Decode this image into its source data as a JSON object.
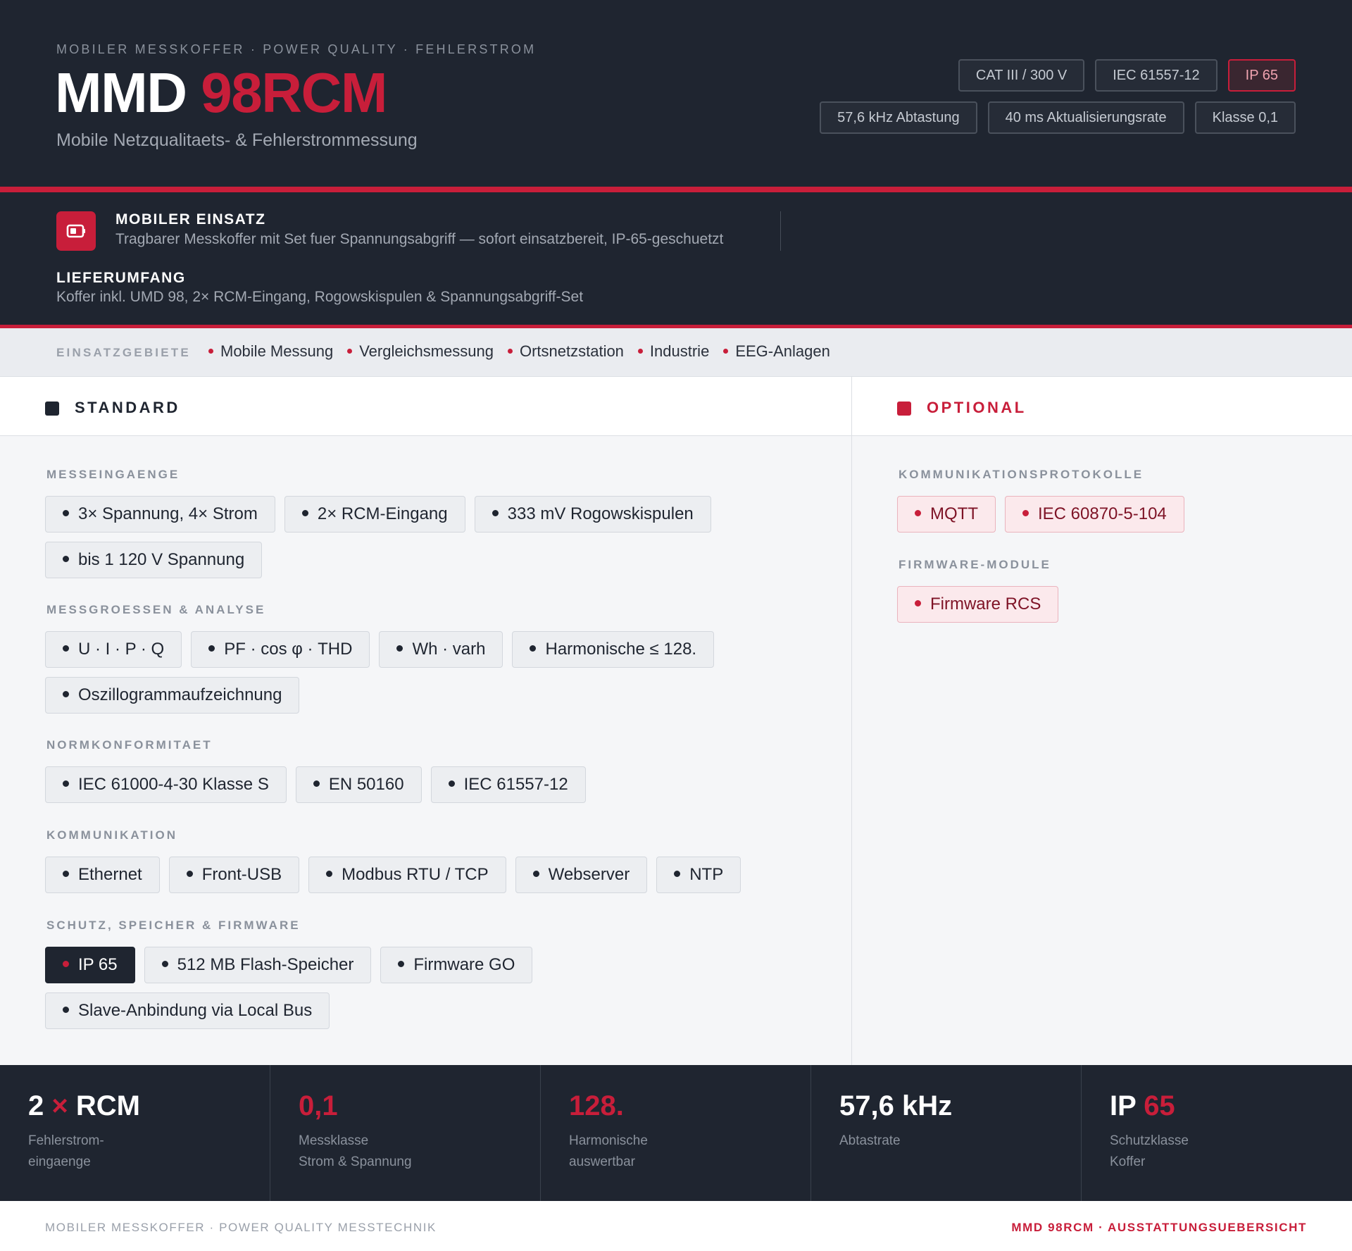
{
  "header": {
    "eyebrow": "MOBILER MESSKOFFER · POWER QUALITY · FEHLERSTROM",
    "title_main": "MMD ",
    "title_accent": "98RCM",
    "subtitle": "Mobile Netzqualitaets- & Fehlerstrommessung",
    "chips_row1": [
      "CAT III / 300 V",
      "IEC 61557-12",
      "IP 65"
    ],
    "chips_row2": [
      "57,6 kHz Abtastung",
      "40 ms Aktualisierungsrate",
      "Klasse 0,1"
    ],
    "accent_color": "#c81e3a",
    "dark_color": "#1f2530"
  },
  "band": {
    "icon": "battery-case-icon",
    "mobile_title": "MOBILER EINSATZ",
    "mobile_text": "Tragbarer Messkoffer mit Set fuer Spannungsabgriff — sofort einsatzbereit, IP-65-geschuetzt",
    "scope_title": "LIEFERUMFANG",
    "scope_text": "Koffer inkl. UMD 98, 2× RCM-Eingang, Rogowskispulen & Spannungsabgriff-Set"
  },
  "areas": {
    "label": "EINSATZGEBIETE",
    "items": [
      "Mobile Messung",
      "Vergleichsmessung",
      "Ortsnetzstation",
      "Industrie",
      "EEG-Anlagen"
    ]
  },
  "standard": {
    "title": "STANDARD",
    "sections": [
      {
        "label": "MESSEINGAENGE",
        "tags": [
          "3× Spannung, 4× Strom",
          "2× RCM-Eingang",
          "333 mV Rogowskispulen",
          "bis 1 120 V Spannung"
        ]
      },
      {
        "label": "MESSGROESSEN & ANALYSE",
        "tags": [
          "U · I · P · Q",
          "PF · cos φ · THD",
          "Wh · varh",
          "Harmonische ≤ 128.",
          "Oszillogrammaufzeichnung"
        ]
      },
      {
        "label": "NORMKONFORMITAET",
        "tags": [
          "IEC 61000-4-30 Klasse S",
          "EN 50160",
          "IEC 61557-12"
        ]
      },
      {
        "label": "KOMMUNIKATION",
        "tags": [
          "Ethernet",
          "Front-USB",
          "Modbus RTU / TCP",
          "Webserver",
          "NTP"
        ]
      },
      {
        "label": "SCHUTZ, SPEICHER & FIRMWARE",
        "tags": [
          "IP 65",
          "512 MB Flash-Speicher",
          "Firmware GO",
          "Slave-Anbindung via Local Bus"
        ]
      }
    ]
  },
  "optional": {
    "title": "OPTIONAL",
    "sections": [
      {
        "label": "KOMMUNIKATIONSPROTOKOLLE",
        "tags": [
          "MQTT",
          "IEC 60870-5-104"
        ]
      },
      {
        "label": "FIRMWARE-MODULE",
        "tags": [
          "Firmware RCS"
        ]
      }
    ]
  },
  "stats": [
    {
      "v1": "2 ",
      "acc": "×",
      "v2": " RCM",
      "l1": "Fehlerstrom-",
      "l2": "eingaenge"
    },
    {
      "v1": "",
      "acc": "0,1",
      "v2": "",
      "l1": "Messklasse",
      "l2": "Strom & Spannung"
    },
    {
      "v1": "",
      "acc": "128.",
      "v2": "",
      "l1": "Harmonische",
      "l2": "auswertbar"
    },
    {
      "v1": "57,6 kHz",
      "acc": "",
      "v2": "",
      "l1": "Abtastrate",
      "l2": ""
    },
    {
      "v1": "IP ",
      "acc": "65",
      "v2": "",
      "l1": "Schutzklasse",
      "l2": "Koffer"
    }
  ],
  "footer": {
    "left": "MOBILER MESSKOFFER · POWER QUALITY MESSTECHNIK",
    "right": "MMD 98RCM · AUSSTATTUNGSUEBERSICHT"
  }
}
